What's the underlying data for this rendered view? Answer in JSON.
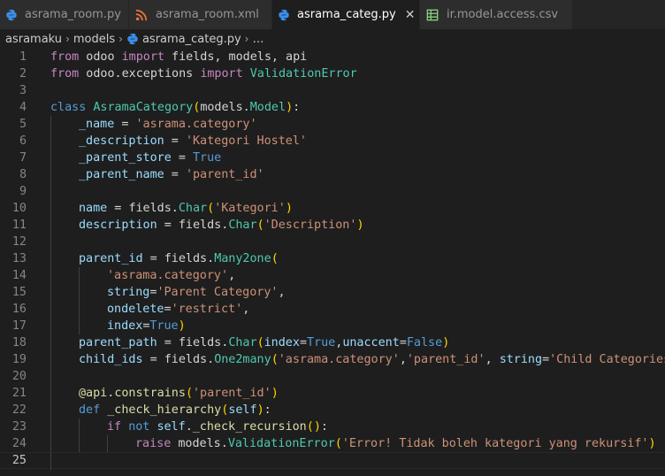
{
  "tabs": [
    {
      "label": "asrama_room.py",
      "icon": "python-icon",
      "active": false
    },
    {
      "label": "asrama_room.xml",
      "icon": "xml-rss-icon",
      "active": false
    },
    {
      "label": "asrama_categ.py",
      "icon": "python-icon",
      "active": true,
      "close": "✕"
    },
    {
      "label": "ir.model.access.csv",
      "icon": "csv-table-icon",
      "active": false
    }
  ],
  "breadcrumb": {
    "items": [
      "asramaku",
      "models",
      "asrama_categ.py",
      "…"
    ],
    "separator": "›"
  },
  "editor": {
    "current_line": 25,
    "lines": [
      {
        "n": "1",
        "indent": 0,
        "tokens": [
          [
            "kw",
            "from"
          ],
          [
            "pl",
            " odoo "
          ],
          [
            "kw",
            "import"
          ],
          [
            "pl",
            " fields, models, api"
          ]
        ]
      },
      {
        "n": "2",
        "indent": 0,
        "tokens": [
          [
            "kw",
            "from"
          ],
          [
            "pl",
            " odoo.exceptions "
          ],
          [
            "kw",
            "import"
          ],
          [
            "pl",
            " "
          ],
          [
            "cls",
            "ValidationError"
          ]
        ]
      },
      {
        "n": "3",
        "indent": 0,
        "tokens": []
      },
      {
        "n": "4",
        "indent": 0,
        "tokens": [
          [
            "kwb",
            "class"
          ],
          [
            "pl",
            " "
          ],
          [
            "cls",
            "AsramaCategory"
          ],
          [
            "br1",
            "("
          ],
          [
            "pl",
            "models."
          ],
          [
            "cls",
            "Model"
          ],
          [
            "br1",
            ")"
          ],
          [
            "pl",
            ":"
          ]
        ]
      },
      {
        "n": "5",
        "indent": 1,
        "tokens": [
          [
            "var",
            "_name"
          ],
          [
            "pl",
            " = "
          ],
          [
            "str",
            "'asrama.category'"
          ]
        ]
      },
      {
        "n": "6",
        "indent": 1,
        "tokens": [
          [
            "var",
            "_description"
          ],
          [
            "pl",
            " = "
          ],
          [
            "str",
            "'Kategori Hostel'"
          ]
        ]
      },
      {
        "n": "7",
        "indent": 1,
        "tokens": [
          [
            "var",
            "_parent_store"
          ],
          [
            "pl",
            " = "
          ],
          [
            "const",
            "True"
          ]
        ]
      },
      {
        "n": "8",
        "indent": 1,
        "tokens": [
          [
            "var",
            "_parent_name"
          ],
          [
            "pl",
            " = "
          ],
          [
            "str",
            "'parent_id'"
          ]
        ]
      },
      {
        "n": "9",
        "indent": 1,
        "tokens": []
      },
      {
        "n": "10",
        "indent": 1,
        "tokens": [
          [
            "var",
            "name"
          ],
          [
            "pl",
            " = "
          ],
          [
            "pl",
            "fields."
          ],
          [
            "cls",
            "Char"
          ],
          [
            "br1",
            "("
          ],
          [
            "str",
            "'Kategori'"
          ],
          [
            "br1",
            ")"
          ]
        ]
      },
      {
        "n": "11",
        "indent": 1,
        "tokens": [
          [
            "var",
            "description"
          ],
          [
            "pl",
            " = "
          ],
          [
            "pl",
            "fields."
          ],
          [
            "cls",
            "Char"
          ],
          [
            "br1",
            "("
          ],
          [
            "str",
            "'Description'"
          ],
          [
            "br1",
            ")"
          ]
        ]
      },
      {
        "n": "12",
        "indent": 1,
        "tokens": []
      },
      {
        "n": "13",
        "indent": 1,
        "tokens": [
          [
            "var",
            "parent_id"
          ],
          [
            "pl",
            " = "
          ],
          [
            "pl",
            "fields."
          ],
          [
            "cls",
            "Many2one"
          ],
          [
            "br1",
            "("
          ]
        ]
      },
      {
        "n": "14",
        "indent": 2,
        "tokens": [
          [
            "str",
            "'asrama.category'"
          ],
          [
            "pl",
            ","
          ]
        ]
      },
      {
        "n": "15",
        "indent": 2,
        "tokens": [
          [
            "var",
            "string"
          ],
          [
            "pl",
            "="
          ],
          [
            "str",
            "'Parent Category'"
          ],
          [
            "pl",
            ","
          ]
        ]
      },
      {
        "n": "16",
        "indent": 2,
        "tokens": [
          [
            "var",
            "ondelete"
          ],
          [
            "pl",
            "="
          ],
          [
            "str",
            "'restrict'"
          ],
          [
            "pl",
            ","
          ]
        ]
      },
      {
        "n": "17",
        "indent": 2,
        "tokens": [
          [
            "var",
            "index"
          ],
          [
            "pl",
            "="
          ],
          [
            "const",
            "True"
          ],
          [
            "br1",
            ")"
          ]
        ]
      },
      {
        "n": "18",
        "indent": 1,
        "tokens": [
          [
            "var",
            "parent_path"
          ],
          [
            "pl",
            " = "
          ],
          [
            "pl",
            "fields."
          ],
          [
            "cls",
            "Char"
          ],
          [
            "br1",
            "("
          ],
          [
            "var",
            "index"
          ],
          [
            "pl",
            "="
          ],
          [
            "const",
            "True"
          ],
          [
            "pl",
            ","
          ],
          [
            "var",
            "unaccent"
          ],
          [
            "pl",
            "="
          ],
          [
            "const",
            "False"
          ],
          [
            "br1",
            ")"
          ]
        ]
      },
      {
        "n": "19",
        "indent": 1,
        "tokens": [
          [
            "var",
            "child_ids"
          ],
          [
            "pl",
            " = "
          ],
          [
            "pl",
            "fields."
          ],
          [
            "cls",
            "One2many"
          ],
          [
            "br1",
            "("
          ],
          [
            "str",
            "'asrama.category'"
          ],
          [
            "pl",
            ","
          ],
          [
            "str",
            "'parent_id'"
          ],
          [
            "pl",
            ", "
          ],
          [
            "var",
            "string"
          ],
          [
            "pl",
            "="
          ],
          [
            "str",
            "'Child Categories'"
          ],
          [
            "br1",
            ")"
          ]
        ]
      },
      {
        "n": "20",
        "indent": 1,
        "tokens": []
      },
      {
        "n": "21",
        "indent": 1,
        "tokens": [
          [
            "dec",
            "@api"
          ],
          [
            "pl",
            "."
          ],
          [
            "fn",
            "constrains"
          ],
          [
            "br1",
            "("
          ],
          [
            "str",
            "'parent_id'"
          ],
          [
            "br1",
            ")"
          ]
        ]
      },
      {
        "n": "22",
        "indent": 1,
        "tokens": [
          [
            "kwb",
            "def"
          ],
          [
            "pl",
            " "
          ],
          [
            "fn",
            "_check_hierarchy"
          ],
          [
            "br1",
            "("
          ],
          [
            "var",
            "self"
          ],
          [
            "br1",
            ")"
          ],
          [
            "pl",
            ":"
          ]
        ]
      },
      {
        "n": "23",
        "indent": 2,
        "tokens": [
          [
            "kw",
            "if"
          ],
          [
            "pl",
            " "
          ],
          [
            "kwb",
            "not"
          ],
          [
            "pl",
            " "
          ],
          [
            "var",
            "self"
          ],
          [
            "pl",
            "."
          ],
          [
            "fn",
            "_check_recursion"
          ],
          [
            "br1",
            "("
          ],
          [
            "br1",
            ")"
          ],
          [
            "pl",
            ":"
          ]
        ]
      },
      {
        "n": "24",
        "indent": 3,
        "tokens": [
          [
            "kw",
            "raise"
          ],
          [
            "pl",
            " models."
          ],
          [
            "cls",
            "ValidationError"
          ],
          [
            "br1",
            "("
          ],
          [
            "str",
            "'Error! Tidak boleh kategori yang rekursif'"
          ],
          [
            "br1",
            ")"
          ]
        ]
      },
      {
        "n": "25",
        "indent": 1,
        "tokens": []
      }
    ]
  },
  "colors": {
    "background": "#1e1e1e",
    "tabbar": "#252526",
    "python_icon": "#3b8eea",
    "xml_icon": "#f0733f",
    "csv_icon": "#89d185"
  }
}
